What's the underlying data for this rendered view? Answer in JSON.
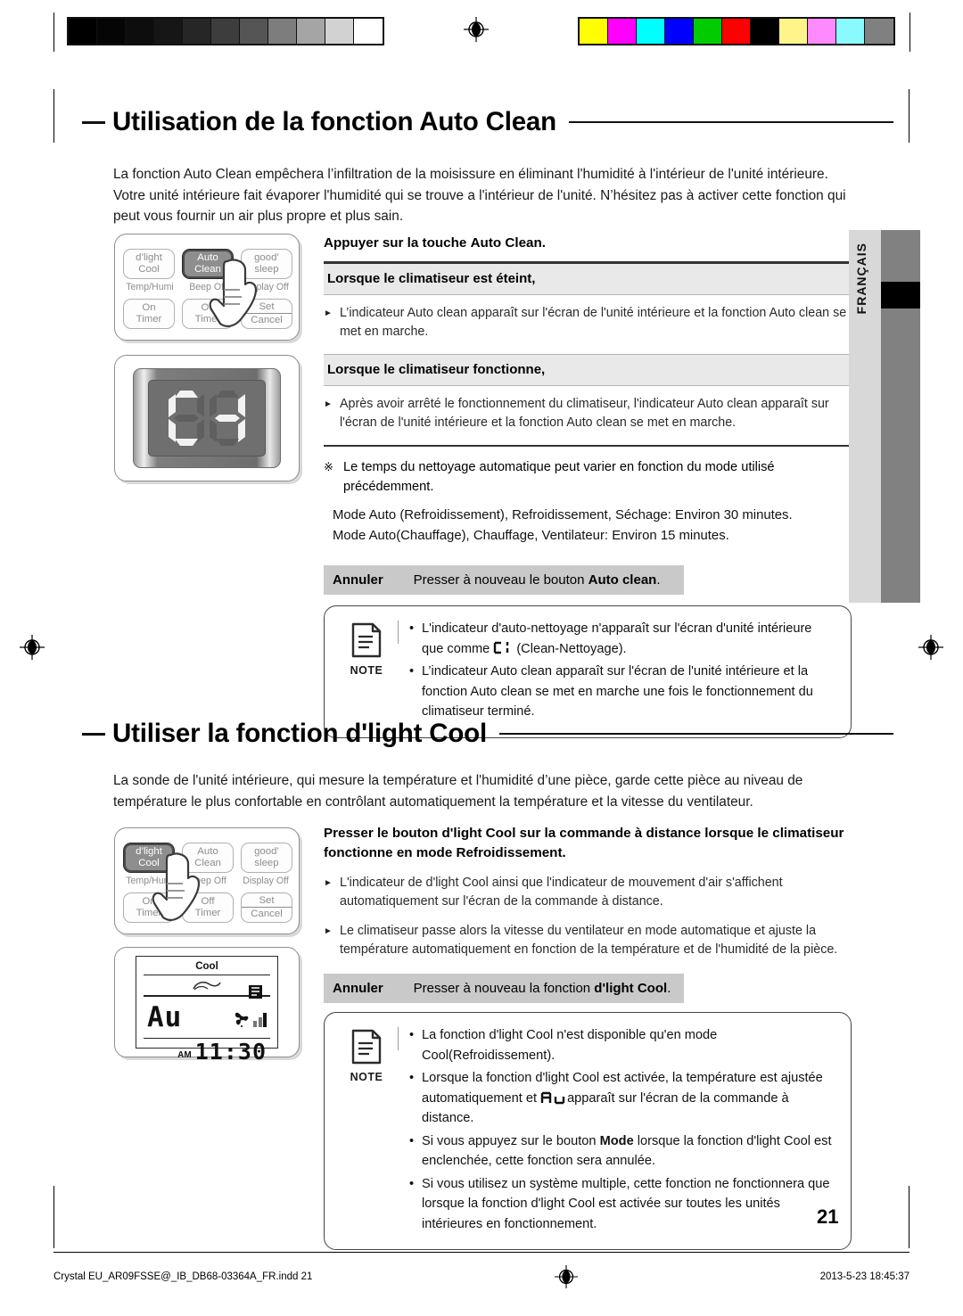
{
  "page": {
    "number": "21",
    "language_tab": "FRANÇAIS"
  },
  "printbar": {
    "gray_swatches": [
      "#000000",
      "#050505",
      "#0d0d0d",
      "#161616",
      "#262626",
      "#3d3d3d",
      "#555555",
      "#7d7d7d",
      "#a5a5a5",
      "#d2d2d2",
      "#ffffff"
    ],
    "color_swatches": [
      "#ffff00",
      "#ff00ff",
      "#00ffff",
      "#0000ff",
      "#00cc00",
      "#ff0000",
      "#000000",
      "#fff48a",
      "#ff8aff",
      "#8afaff",
      "#808080"
    ]
  },
  "section1": {
    "title": "Utilisation de la fonction Auto Clean",
    "intro": "La fonction Auto Clean empêchera l’infiltration de la moisissure en éliminant l'humidité à l'intérieur de l'unité intérieure. Votre unité intérieure fait évaporer l'humidité qui se trouve a l'intérieur de l'unité. N’hésitez pas à activer cette fonction qui peut vous fournir un air plus propre et plus sain.",
    "lead_prefix": "Appuyer sur la touche ",
    "lead_bold": "Auto Clean",
    "lead_suffix": ".",
    "band1": "Lorsque le climatiseur est éteint,",
    "bullet1": "L’indicateur Auto clean apparaît sur l'écran de l'unité intérieure et la fonction Auto clean se met en marche.",
    "band2": "Lorsque le climatiseur fonctionne,",
    "bullet2": "Après avoir arrêté le fonctionnement du climatiseur, l'indicateur Auto clean apparaît sur l'écran de l'unité intérieure et la fonction Auto clean se met en marche.",
    "star_mark": "※",
    "star_text": "Le temps du nettoyage automatique peut varier en fonction du mode utilisé précédemment.",
    "mode_line1": "Mode Auto (Refroidissement), Refroidissement, Séchage: Environ 30 minutes.",
    "mode_line2": "Mode  Auto(Chauffage), Chauffage, Ventilateur: Environ 15 minutes.",
    "cancel_label": "Annuler",
    "cancel_prefix": "Presser à nouveau le bouton ",
    "cancel_bold": "Auto clean",
    "cancel_suffix": ".",
    "note_label": "NOTE",
    "note_items_a": "L'indicateur d'auto-nettoyage n'apparaît sur l'écran d'unité intérieure que comme",
    "note_items_a_tail": "(Clean-Nettoyage).",
    "note_items_b": "L’indicateur Auto clean apparaît sur l'écran de l'unité intérieure et la fonction Auto clean se met en marche une fois le fonctionnement du climatiseur terminé."
  },
  "section2": {
    "title": "Utiliser la fonction d'light Cool",
    "intro": "La sonde de l'unité intérieure, qui mesure la température et l'humidité d’une pièce, garde cette pièce au niveau de température le plus confortable en contrôlant automatiquement la température et la vitesse du ventilateur.",
    "lead_prefix": "Presser le bouton ",
    "lead_bold": "d'light Cool",
    "lead_suffix": " sur la commande à distance lorsque le climatiseur fonctionne en mode Refroidissement.",
    "bullet1": "L'indicateur de d'light Cool ainsi que l'indicateur de mouvement d'air s'affichent automatiquement sur l'écran de la commande à distance.",
    "bullet2": "Le climatiseur passe alors la vitesse du ventilateur en mode automatique et ajuste la température automatiquement en fonction de la température et de l'humidité de la pièce.",
    "cancel_label": "Annuler",
    "cancel_prefix": "Presser à nouveau la fonction ",
    "cancel_bold": "d'light Cool",
    "cancel_suffix": ".",
    "note_label": "NOTE",
    "note_item1": "La fonction d'light Cool n'est disponible qu'en mode Cool(Refroidissement).",
    "note_item2_a": "Lorsque la fonction d'light Cool est activée, la température est ajustée automatiquement et",
    "note_item2_b": "apparaît sur l'écran de la commande à distance.",
    "note_item3_a": "Si vous appuyez sur le bouton ",
    "note_item3_bold": "Mode",
    "note_item3_b": " lorsque la fonction d'light Cool est enclenchée, cette fonction sera annulée.",
    "note_item4": "Si vous utilisez un système multiple, cette fonction ne fonctionnera que lorsque la fonction d'light Cool est activée sur toutes les unités intérieures en fonctionnement."
  },
  "remote_top": {
    "buttons_row1": [
      "d’light\nCool",
      "Auto\nClean",
      "good’\nsleep"
    ],
    "btn1_line1": "d’light",
    "btn1_line2": "Cool",
    "btn2_line1": "Auto",
    "btn2_line2": "Clean",
    "btn3_line1": "good’",
    "btn3_line2": "sleep",
    "labels": [
      "Temp/Humi",
      "Beep Off",
      "Display Off"
    ],
    "btn4_line1": "On",
    "btn4_line2": "Timer",
    "btn5_line1": "Off",
    "btn5_line2": "Timer",
    "btn6_line1": "Set",
    "btn6_line2": "Cancel",
    "active_button": "Auto Clean"
  },
  "remote_bottom": {
    "btn1_line1": "d’light",
    "btn1_line2": "Cool",
    "btn2_line1": "Auto",
    "btn2_line2": "Clean",
    "btn3_line1": "good’",
    "btn3_line2": "sleep",
    "labels": [
      "Temp/Humi",
      "Beep Off",
      "Display Off"
    ],
    "btn4_line1": "On",
    "btn4_line2": "Timer",
    "btn5_line1": "Off",
    "btn5_line2": "Timer",
    "btn6_line1": "Set",
    "btn6_line2": "Cancel",
    "active_button": "d’light Cool"
  },
  "unit_display": {
    "segments_value": "CL"
  },
  "remote_lcd": {
    "mode": "Cool",
    "big_value": "Au",
    "ampm": "AM",
    "time": "11:30"
  },
  "footer": {
    "left": "Crystal  EU_AR09FSSE@_IB_DB68-03364A_FR.indd   21",
    "right": "2013-5-23   18:45:37"
  }
}
